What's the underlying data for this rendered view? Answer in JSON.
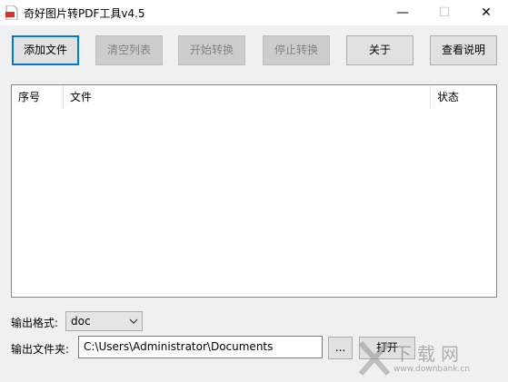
{
  "window": {
    "title": "奇好图片转PDF工具v4.5",
    "minimize_glyph": "—",
    "maximize_glyph": "☐",
    "close_glyph": "✕"
  },
  "toolbar": {
    "add_file": "添加文件",
    "clear_list": "清空列表",
    "start_convert": "开始转换",
    "stop_convert": "停止转换",
    "about": "关于",
    "help": "查看说明"
  },
  "list": {
    "columns": [
      "序号",
      "文件",
      "状态"
    ],
    "rows": []
  },
  "output": {
    "format_label": "输出格式:",
    "format_value": "doc",
    "folder_label": "输出文件夹:",
    "folder_value": "C:\\Users\\Administrator\\Documents",
    "browse_label": "...",
    "open_label": "打开"
  },
  "watermark": {
    "text": "下载网",
    "url": "www.downbank.cn"
  },
  "icons": {
    "app": "pdf-app-icon",
    "chevron": "chevron-down-icon"
  },
  "colors": {
    "accent": "#0078d7",
    "pdf_icon": "#d9342b"
  }
}
